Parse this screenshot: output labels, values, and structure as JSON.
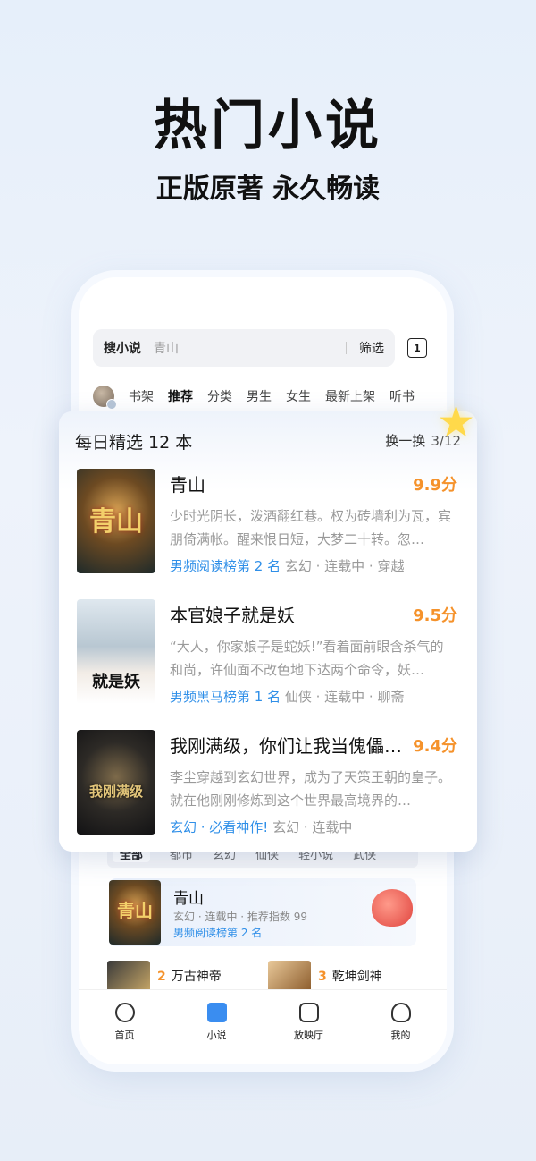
{
  "hero": {
    "title": "热门小说",
    "subtitle": "正版原著 永久畅读"
  },
  "search": {
    "label": "搜小说",
    "placeholder": "青山",
    "filter": "筛选",
    "tab_count": "1"
  },
  "tabs": [
    "书架",
    "推荐",
    "分类",
    "男生",
    "女生",
    "最新上架",
    "听书"
  ],
  "daily": {
    "title": "每日精选 12 本",
    "swap": "换一换",
    "page": "3/12",
    "books": [
      {
        "title": "青山",
        "score": "9.9分",
        "desc": "少时光阴长，泼酒翻红巷。权为砖墙利为瓦，宾朋倚满帐。醒来恨日短，大梦二十转。忽…",
        "rank": "男频阅读榜第 2 名",
        "tags": " 玄幻 · 连载中 · 穿越",
        "cover_text": "青山"
      },
      {
        "title": "本官娘子就是妖",
        "score": "9.5分",
        "desc": "“大人，你家娘子是蛇妖!”看着面前眼含杀气的和尚，许仙面不改色地下达两个命令，妖…",
        "rank": "男频黑马榜第 1 名",
        "tags": " 仙侠 · 连载中 · 聊斋",
        "cover_text": "就是妖"
      },
      {
        "title": "我刚满级，你们让我当傀儡…",
        "score": "9.4分",
        "desc": "李尘穿越到玄幻世界，成为了天策王朝的皇子。就在他刚刚修炼到这个世界最高境界的…",
        "rank": "玄幻 · 必看神作!",
        "tags": " 玄幻 · 连载中",
        "cover_text": "我刚满级"
      }
    ]
  },
  "categories": [
    "全部",
    "都市",
    "玄幻",
    "仙侠",
    "轻小说",
    "武侠"
  ],
  "featured": {
    "title": "青山",
    "meta": "玄幻 · 连载中 · 推荐指数 99",
    "rank": "男频阅读榜第 2 名",
    "cover_text": "青山"
  },
  "ranking": [
    {
      "num": "2",
      "title": "万古神帝"
    },
    {
      "num": "3",
      "title": "乾坤剑神"
    }
  ],
  "bottom_nav": [
    "首页",
    "小说",
    "放映厅",
    "我的"
  ],
  "colors": {
    "accent_blue": "#2f8fe8",
    "score_orange": "#f5922b"
  }
}
